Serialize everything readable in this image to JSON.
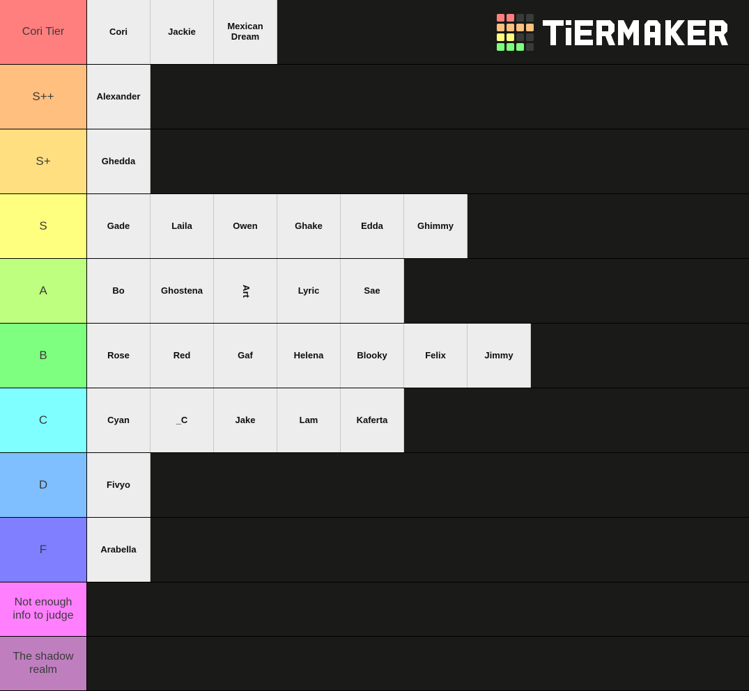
{
  "app": {
    "brand": "TIERMAKER",
    "logo_colors": {
      "red": "#ff7f7f",
      "orange": "#ffbf7f",
      "yellow": "#ffff7f",
      "green": "#7fff7f",
      "dark": "#3a3a38"
    },
    "logo_pattern": [
      [
        "red",
        "red",
        "dark",
        "dark"
      ],
      [
        "orange",
        "orange",
        "orange",
        "orange"
      ],
      [
        "yellow",
        "yellow",
        "dark",
        "dark"
      ],
      [
        "green",
        "green",
        "green",
        "dark"
      ]
    ],
    "background_color": "#1a1a18",
    "tile_color": "#ededed"
  },
  "tiers": [
    {
      "label": "Cori Tier",
      "color": "#ff7f7f",
      "items": [
        {
          "name": "Cori",
          "rotated": false
        },
        {
          "name": "Jackie",
          "rotated": false
        },
        {
          "name": "Mexican Dream",
          "rotated": false
        }
      ]
    },
    {
      "label": "S++",
      "color": "#ffbf7f",
      "items": [
        {
          "name": "Alexander",
          "rotated": false
        }
      ]
    },
    {
      "label": "S+",
      "color": "#ffdf7f",
      "items": [
        {
          "name": "Ghedda",
          "rotated": false
        }
      ]
    },
    {
      "label": "S",
      "color": "#ffff7f",
      "items": [
        {
          "name": "Gade",
          "rotated": false
        },
        {
          "name": "Laila",
          "rotated": false
        },
        {
          "name": "Owen",
          "rotated": false
        },
        {
          "name": "Ghake",
          "rotated": false
        },
        {
          "name": "Edda",
          "rotated": false
        },
        {
          "name": "Ghimmy",
          "rotated": false
        }
      ]
    },
    {
      "label": "A",
      "color": "#bfff7f",
      "items": [
        {
          "name": "Bo",
          "rotated": false
        },
        {
          "name": "Ghostena",
          "rotated": false
        },
        {
          "name": "Art",
          "rotated": true
        },
        {
          "name": "Lyric",
          "rotated": false
        },
        {
          "name": "Sae",
          "rotated": false
        }
      ]
    },
    {
      "label": "B",
      "color": "#7fff7f",
      "items": [
        {
          "name": "Rose",
          "rotated": false
        },
        {
          "name": "Red",
          "rotated": false
        },
        {
          "name": "Gaf",
          "rotated": false
        },
        {
          "name": "Helena",
          "rotated": false
        },
        {
          "name": "Blooky",
          "rotated": false
        },
        {
          "name": "Felix",
          "rotated": false
        },
        {
          "name": "Jimmy",
          "rotated": false
        }
      ]
    },
    {
      "label": "C",
      "color": "#7fffff",
      "items": [
        {
          "name": "Cyan",
          "rotated": false
        },
        {
          "name": "_C",
          "rotated": false
        },
        {
          "name": "Jake",
          "rotated": false
        },
        {
          "name": "Lam",
          "rotated": false
        },
        {
          "name": "Kaferta",
          "rotated": false
        }
      ]
    },
    {
      "label": "D",
      "color": "#7fbfff",
      "items": [
        {
          "name": "Fivyo",
          "rotated": false
        }
      ]
    },
    {
      "label": "F",
      "color": "#7f7fff",
      "items": [
        {
          "name": "Arabella",
          "rotated": false
        }
      ]
    },
    {
      "label": "Not enough info to judge",
      "color": "#ff7fff",
      "short": true,
      "items": []
    },
    {
      "label": "The shadow realm",
      "color": "#bf7fbf",
      "short": true,
      "items": []
    }
  ]
}
